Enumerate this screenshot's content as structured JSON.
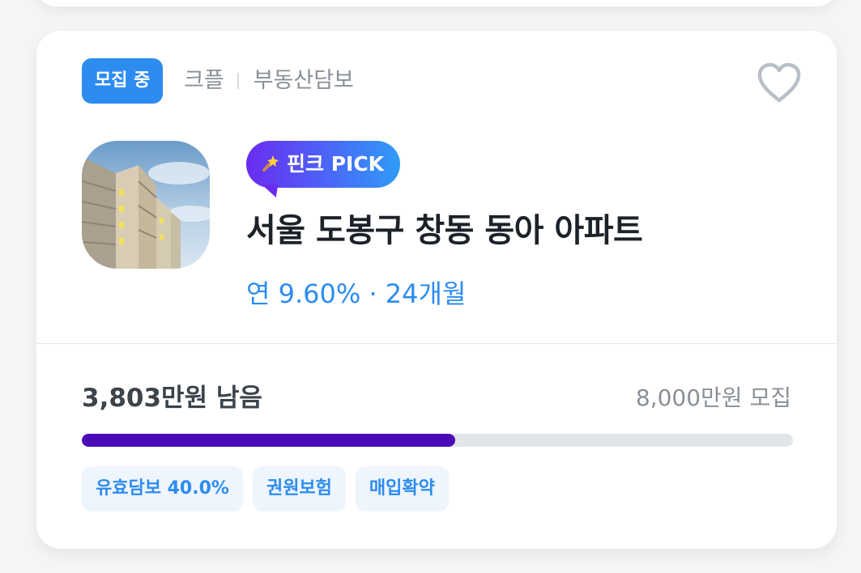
{
  "card": {
    "status_badge": "모집 중",
    "category_primary": "크플",
    "category_secondary": "부동산담보",
    "pick_label": "핀크 PICK",
    "title": "서울 도봉구 창동 동아 아파트",
    "rate_line": "연 9.60% · 24개월",
    "remaining_text": "3,803만원 남음",
    "goal_text": "8,000만원 모집",
    "progress_percent": 52.5,
    "tags": [
      "유효담보 40.0%",
      "권원보험",
      "매입확약"
    ],
    "icons": {
      "favorite": "heart-icon",
      "pick": "magic-wand-icon"
    },
    "colors": {
      "accent": "#2d8cf0",
      "progress": "#4b0ab8",
      "pick_gradient_start": "#6a2cf0",
      "pick_gradient_end": "#2f9cf7"
    }
  }
}
